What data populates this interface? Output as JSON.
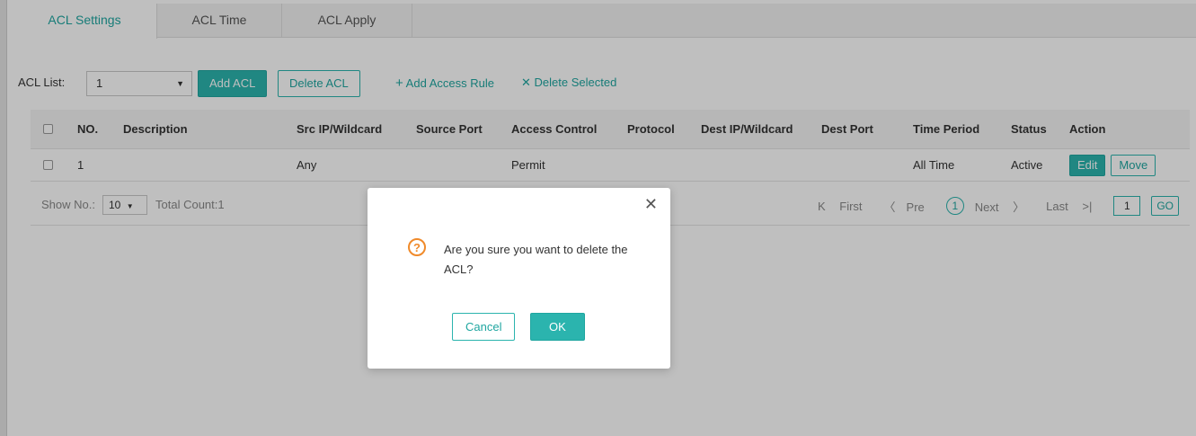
{
  "tabs": [
    {
      "label": "ACL Settings",
      "active": true
    },
    {
      "label": "ACL Time",
      "active": false
    },
    {
      "label": "ACL Apply",
      "active": false
    }
  ],
  "toolbar": {
    "acl_list_label": "ACL List:",
    "acl_list_value": "1",
    "add_acl": "Add ACL",
    "delete_acl": "Delete ACL",
    "add_access_rule": "Add Access Rule",
    "delete_selected": "Delete Selected"
  },
  "table": {
    "headers": [
      "NO.",
      "Description",
      "Src IP/Wildcard",
      "Source Port",
      "Access Control",
      "Protocol",
      "Dest IP/Wildcard",
      "Dest Port",
      "Time Period",
      "Status",
      "Action"
    ],
    "rows": [
      {
        "no": "1",
        "description": "",
        "src_ip": "Any",
        "source_port": "",
        "access_control": "Permit",
        "protocol": "",
        "dest_ip": "",
        "dest_port": "",
        "time_period": "All Time",
        "status": "Active",
        "edit": "Edit",
        "move": "Move"
      }
    ]
  },
  "footer": {
    "show_no_label": "Show No.:",
    "page_size": "10",
    "total_count": "Total Count:1",
    "first": "First",
    "pre": "Pre",
    "current_page": "1",
    "next": "Next",
    "last": "Last",
    "page_input": "1",
    "go": "GO"
  },
  "modal": {
    "message": "Are you sure you want to delete the ACL?",
    "cancel": "Cancel",
    "ok": "OK"
  },
  "colors": {
    "accent": "#2bb4ae",
    "warning": "#f08a2a"
  },
  "icons": {
    "plus": "plus-icon",
    "times": "close-icon",
    "question": "question-circle-icon",
    "dropdown": "caret-down-icon"
  }
}
